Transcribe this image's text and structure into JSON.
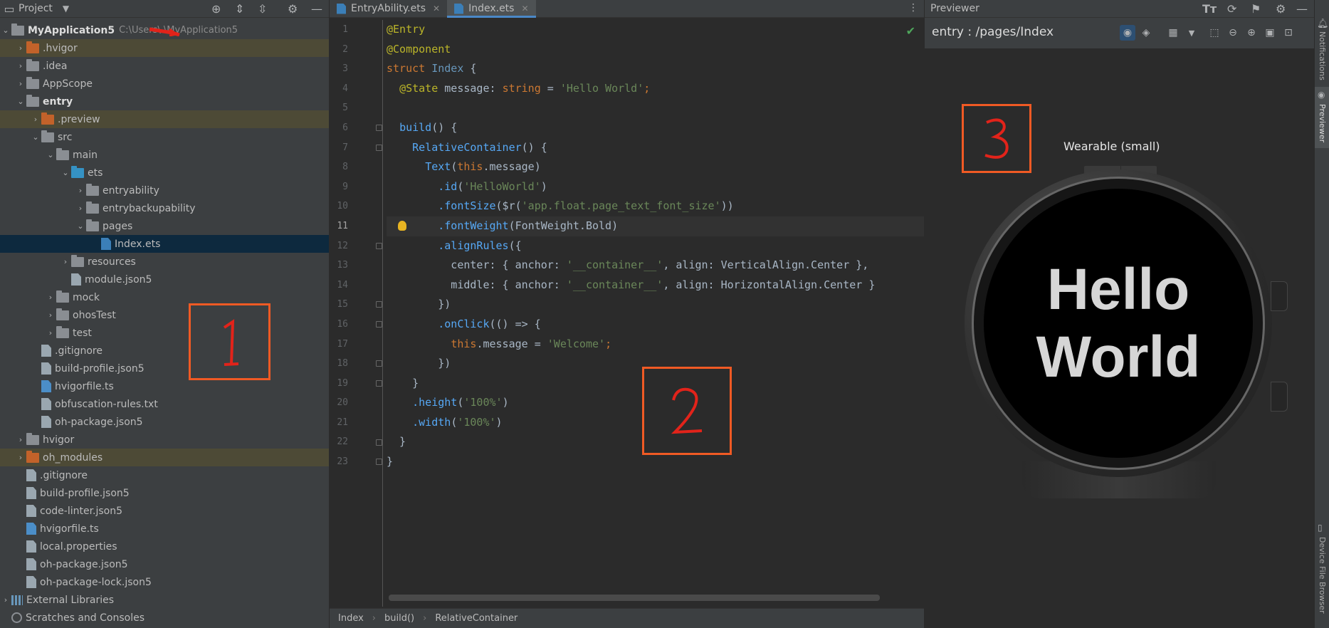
{
  "project": {
    "header": {
      "title": "Project",
      "dropdown_icon": "chevron-down-icon"
    },
    "root": {
      "name": "MyApplication5",
      "path": "C:\\Users\\      \\MyApplication5"
    },
    "tree": [
      {
        "label": ".hvigor",
        "depth": 1,
        "arrow": "›",
        "icon": "folder-orange",
        "excluded": true
      },
      {
        "label": ".idea",
        "depth": 1,
        "arrow": "›",
        "icon": "folder"
      },
      {
        "label": "AppScope",
        "depth": 1,
        "arrow": "›",
        "icon": "folder"
      },
      {
        "label": "entry",
        "depth": 1,
        "arrow": "⌄",
        "icon": "folder",
        "bold": true
      },
      {
        "label": ".preview",
        "depth": 2,
        "arrow": "›",
        "icon": "folder-orange",
        "excluded": true
      },
      {
        "label": "src",
        "depth": 2,
        "arrow": "⌄",
        "icon": "folder"
      },
      {
        "label": "main",
        "depth": 3,
        "arrow": "⌄",
        "icon": "folder"
      },
      {
        "label": "ets",
        "depth": 4,
        "arrow": "⌄",
        "icon": "folder-blue"
      },
      {
        "label": "entryability",
        "depth": 5,
        "arrow": "›",
        "icon": "folder"
      },
      {
        "label": "entrybackupability",
        "depth": 5,
        "arrow": "›",
        "icon": "folder"
      },
      {
        "label": "pages",
        "depth": 5,
        "arrow": "⌄",
        "icon": "folder"
      },
      {
        "label": "Index.ets",
        "depth": 6,
        "arrow": "",
        "icon": "file-ets",
        "selected": true
      },
      {
        "label": "resources",
        "depth": 4,
        "arrow": "›",
        "icon": "folder"
      },
      {
        "label": "module.json5",
        "depth": 4,
        "arrow": "",
        "icon": "file"
      },
      {
        "label": "mock",
        "depth": 3,
        "arrow": "›",
        "icon": "folder"
      },
      {
        "label": "ohosTest",
        "depth": 3,
        "arrow": "›",
        "icon": "folder"
      },
      {
        "label": "test",
        "depth": 3,
        "arrow": "›",
        "icon": "folder"
      },
      {
        "label": ".gitignore",
        "depth": 2,
        "arrow": "",
        "icon": "file"
      },
      {
        "label": "build-profile.json5",
        "depth": 2,
        "arrow": "",
        "icon": "file"
      },
      {
        "label": "hvigorfile.ts",
        "depth": 2,
        "arrow": "",
        "icon": "file-ts"
      },
      {
        "label": "obfuscation-rules.txt",
        "depth": 2,
        "arrow": "",
        "icon": "file"
      },
      {
        "label": "oh-package.json5",
        "depth": 2,
        "arrow": "",
        "icon": "file"
      },
      {
        "label": "hvigor",
        "depth": 1,
        "arrow": "›",
        "icon": "folder"
      },
      {
        "label": "oh_modules",
        "depth": 1,
        "arrow": "›",
        "icon": "folder-orange",
        "excluded": true
      },
      {
        "label": ".gitignore",
        "depth": 1,
        "arrow": "",
        "icon": "file"
      },
      {
        "label": "build-profile.json5",
        "depth": 1,
        "arrow": "",
        "icon": "file"
      },
      {
        "label": "code-linter.json5",
        "depth": 1,
        "arrow": "",
        "icon": "file"
      },
      {
        "label": "hvigorfile.ts",
        "depth": 1,
        "arrow": "",
        "icon": "file-ts"
      },
      {
        "label": "local.properties",
        "depth": 1,
        "arrow": "",
        "icon": "file"
      },
      {
        "label": "oh-package.json5",
        "depth": 1,
        "arrow": "",
        "icon": "file"
      },
      {
        "label": "oh-package-lock.json5",
        "depth": 1,
        "arrow": "",
        "icon": "file"
      },
      {
        "label": "External Libraries",
        "depth": 0,
        "arrow": "›",
        "icon": "libs"
      },
      {
        "label": "Scratches and Consoles",
        "depth": 0,
        "arrow": "",
        "icon": "scratch"
      }
    ]
  },
  "editor": {
    "tabs": [
      {
        "label": "EntryAbility.ets",
        "active": false
      },
      {
        "label": "Index.ets",
        "active": true
      }
    ],
    "current_line": 11,
    "lines": [
      [
        [
          "@Entry",
          "ann"
        ]
      ],
      [
        [
          "@Component",
          "ann"
        ]
      ],
      [
        [
          "struct ",
          "kw"
        ],
        [
          "Index",
          "type"
        ],
        [
          " {",
          "plain"
        ]
      ],
      [
        [
          "  ",
          "plain"
        ],
        [
          "@State ",
          "ann"
        ],
        [
          "message",
          "plain"
        ],
        [
          ": ",
          "plain"
        ],
        [
          "string",
          "kw"
        ],
        [
          " = ",
          "plain"
        ],
        [
          "'Hello World'",
          "str"
        ],
        [
          ";",
          "punc"
        ]
      ],
      [],
      [
        [
          "  ",
          "plain"
        ],
        [
          "build",
          "fn"
        ],
        [
          "() {",
          "plain"
        ]
      ],
      [
        [
          "    ",
          "plain"
        ],
        [
          "RelativeContainer",
          "fn"
        ],
        [
          "() {",
          "plain"
        ]
      ],
      [
        [
          "      ",
          "plain"
        ],
        [
          "Text",
          "fn"
        ],
        [
          "(",
          "plain"
        ],
        [
          "this",
          "kw"
        ],
        [
          ".message)",
          "plain"
        ]
      ],
      [
        [
          "        ",
          "plain"
        ],
        [
          ".id",
          "fn"
        ],
        [
          "(",
          "plain"
        ],
        [
          "'HelloWorld'",
          "str"
        ],
        [
          ")",
          "plain"
        ]
      ],
      [
        [
          "        ",
          "plain"
        ],
        [
          ".fontSize",
          "fn"
        ],
        [
          "($r(",
          "plain"
        ],
        [
          "'app.float.page_text_font_size'",
          "str"
        ],
        [
          "))",
          "plain"
        ]
      ],
      [
        [
          "        ",
          "plain"
        ],
        [
          ".fontWeight",
          "fn"
        ],
        [
          "(FontWeight.Bold)",
          "plain"
        ]
      ],
      [
        [
          "        ",
          "plain"
        ],
        [
          ".alignRules",
          "fn"
        ],
        [
          "({",
          "plain"
        ]
      ],
      [
        [
          "          center: { anchor: ",
          "plain"
        ],
        [
          "'__container__'",
          "str"
        ],
        [
          ", align: VerticalAlign.Center },",
          "plain"
        ]
      ],
      [
        [
          "          middle: { anchor: ",
          "plain"
        ],
        [
          "'__container__'",
          "str"
        ],
        [
          ", align: HorizontalAlign.Center }",
          "plain"
        ]
      ],
      [
        [
          "        })",
          "plain"
        ]
      ],
      [
        [
          "        ",
          "plain"
        ],
        [
          ".onClick",
          "fn"
        ],
        [
          "(() => {",
          "plain"
        ]
      ],
      [
        [
          "          ",
          "plain"
        ],
        [
          "this",
          "kw"
        ],
        [
          ".message = ",
          "plain"
        ],
        [
          "'Welcome'",
          "str"
        ],
        [
          ";",
          "punc"
        ]
      ],
      [
        [
          "        })",
          "plain"
        ]
      ],
      [
        [
          "    }",
          "plain"
        ]
      ],
      [
        [
          "    ",
          "plain"
        ],
        [
          ".height",
          "fn"
        ],
        [
          "(",
          "plain"
        ],
        [
          "'100%'",
          "str"
        ],
        [
          ")",
          "plain"
        ]
      ],
      [
        [
          "    ",
          "plain"
        ],
        [
          ".width",
          "fn"
        ],
        [
          "(",
          "plain"
        ],
        [
          "'100%'",
          "str"
        ],
        [
          ")",
          "plain"
        ]
      ],
      [
        [
          "  }",
          "plain"
        ]
      ],
      [
        [
          "}",
          "plain"
        ]
      ]
    ],
    "breadcrumbs": [
      "Index",
      "build()",
      "RelativeContainer"
    ]
  },
  "previewer": {
    "header": "Previewer",
    "route": "entry : /pages/Index",
    "device": "Wearable (small)",
    "screen_text": "Hello World",
    "nav_back_icon": "back-triangle-icon",
    "nav_more_icon": "more-dots-icon"
  },
  "right_sidebar": [
    "Notifications",
    "Previewer",
    "Device File Browser"
  ],
  "annotations": [
    "1",
    "2",
    "3"
  ],
  "colors": {
    "accent": "#4a88c7",
    "annotation": "#f05a24",
    "selection": "#0d293e",
    "excluded": "#4d4a36"
  }
}
